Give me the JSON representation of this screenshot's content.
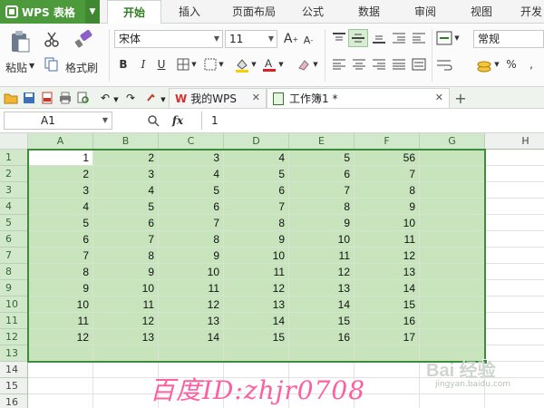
{
  "app": {
    "title": "WPS 表格"
  },
  "menu": {
    "tabs": [
      "开始",
      "插入",
      "页面布局",
      "公式",
      "数据",
      "审阅",
      "视图",
      "开发"
    ],
    "active": 0
  },
  "ribbon": {
    "paste_label": "粘贴",
    "format_painter_label": "格式刷",
    "font_name": "宋体",
    "font_size": "11",
    "number_format": "常规",
    "percent": "%",
    "bold": "B",
    "italic": "I",
    "underline": "U"
  },
  "doc_tabs": [
    {
      "label": "我的WPS",
      "active": false
    },
    {
      "label": "工作簿1 *",
      "active": true
    }
  ],
  "formula_bar": {
    "name_box": "A1",
    "fx": "fx",
    "value": "1"
  },
  "columns": [
    "A",
    "B",
    "C",
    "D",
    "E",
    "F",
    "G",
    "H"
  ],
  "rows": [
    "1",
    "2",
    "3",
    "4",
    "5",
    "6",
    "7",
    "8",
    "9",
    "10",
    "11",
    "12",
    "13",
    "14",
    "15",
    "16"
  ],
  "cells": [
    [
      "1",
      "2",
      "3",
      "4",
      "5",
      "56",
      ""
    ],
    [
      "2",
      "3",
      "4",
      "5",
      "6",
      "7",
      ""
    ],
    [
      "3",
      "4",
      "5",
      "6",
      "7",
      "8",
      ""
    ],
    [
      "4",
      "5",
      "6",
      "7",
      "8",
      "9",
      ""
    ],
    [
      "5",
      "6",
      "7",
      "8",
      "9",
      "10",
      ""
    ],
    [
      "6",
      "7",
      "8",
      "9",
      "10",
      "11",
      ""
    ],
    [
      "7",
      "8",
      "9",
      "10",
      "11",
      "12",
      ""
    ],
    [
      "8",
      "9",
      "10",
      "11",
      "12",
      "13",
      ""
    ],
    [
      "9",
      "10",
      "11",
      "12",
      "13",
      "14",
      ""
    ],
    [
      "10",
      "11",
      "12",
      "13",
      "14",
      "15",
      ""
    ],
    [
      "11",
      "12",
      "13",
      "14",
      "15",
      "16",
      ""
    ],
    [
      "12",
      "13",
      "14",
      "15",
      "16",
      "17",
      ""
    ]
  ],
  "watermark": "百度ID:zhjr0708",
  "baidu_logo": {
    "main": "Bai 经验",
    "sub": "jingyan.baidu.com"
  },
  "colors": {
    "brand": "#4d9a3d",
    "selection_fill": "#c7e4bd",
    "selection_border": "#3c8c3c",
    "watermark": "#ff5fa0"
  }
}
